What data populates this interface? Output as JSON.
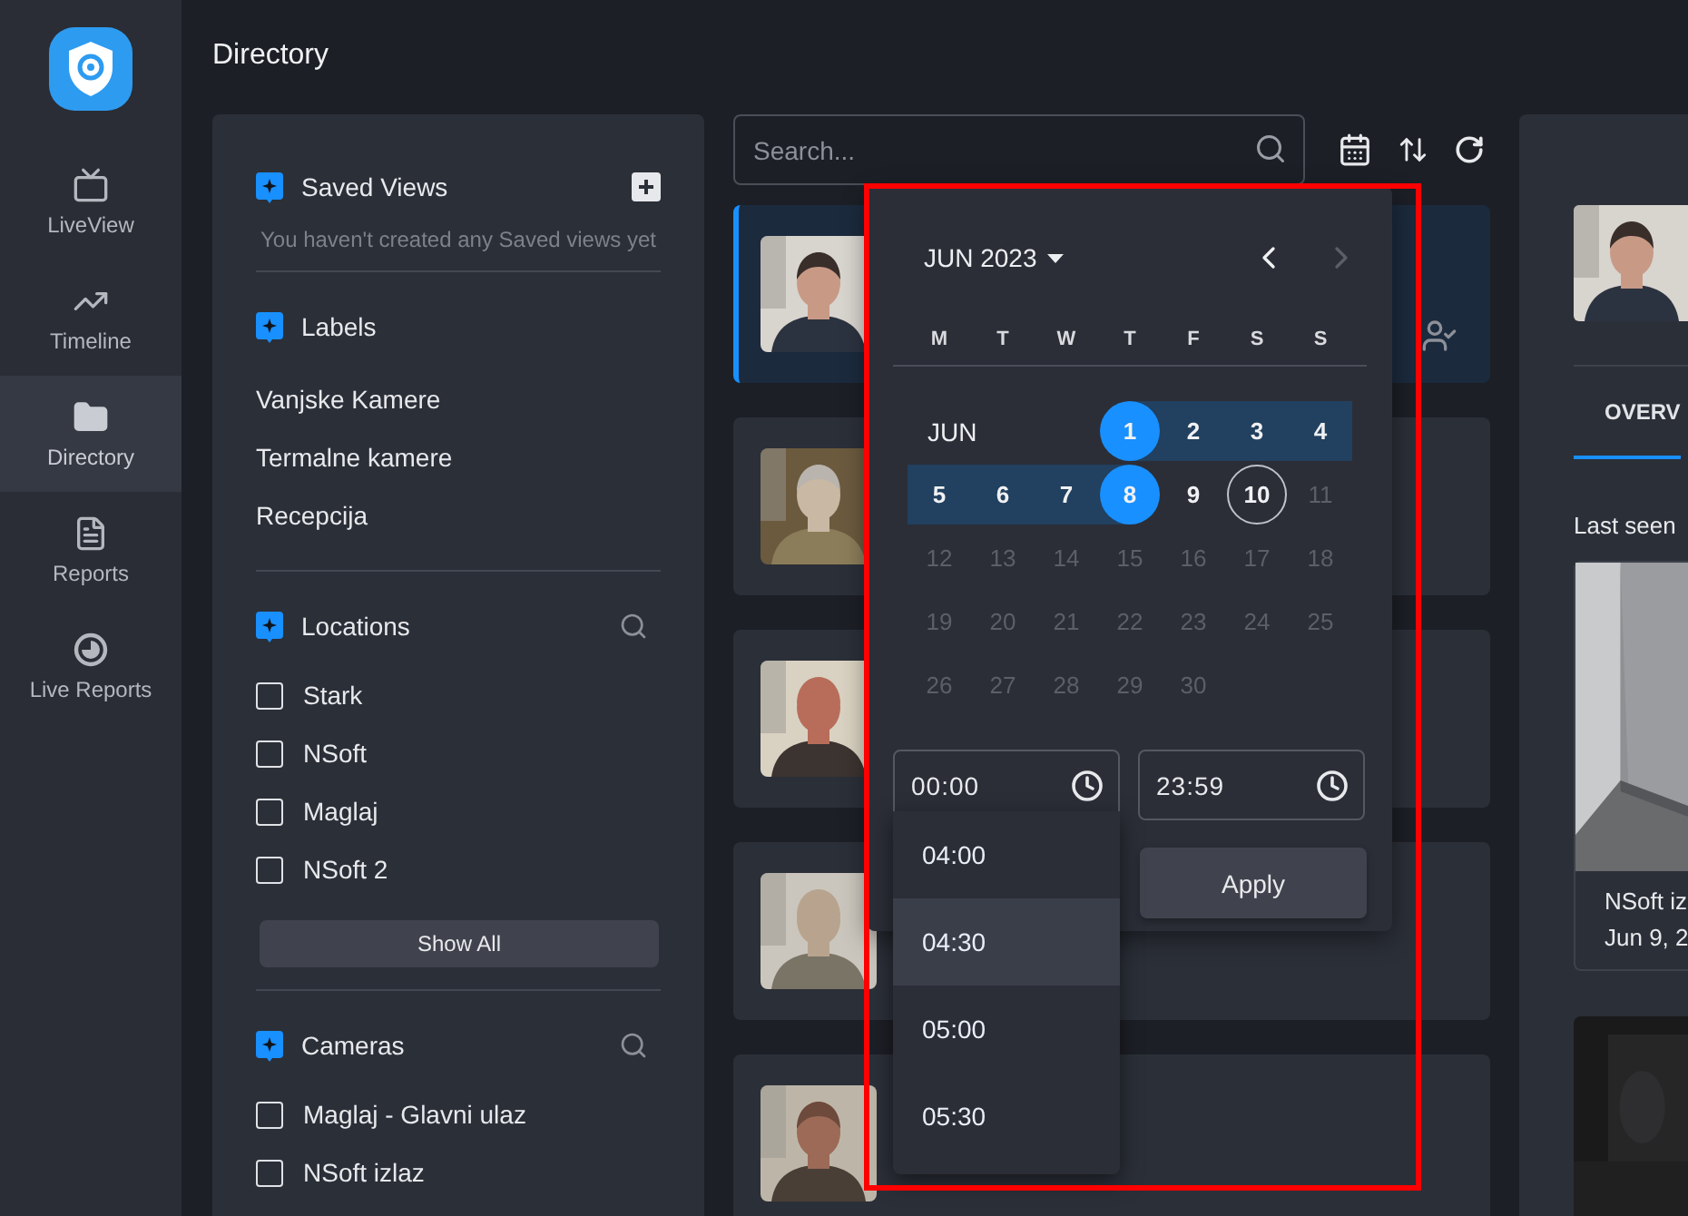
{
  "nav": [
    {
      "label": "LiveView",
      "selected": false
    },
    {
      "label": "Timeline",
      "selected": false
    },
    {
      "label": "Directory",
      "selected": true
    },
    {
      "label": "Reports",
      "selected": false
    },
    {
      "label": "Live Reports",
      "selected": false
    }
  ],
  "page_title": "Directory",
  "filters": {
    "saved_views": {
      "title": "Saved Views",
      "empty_note": "You haven't created any Saved views yet"
    },
    "labels": {
      "title": "Labels",
      "items": [
        "Vanjske Kamere",
        "Termalne kamere",
        "Recepcija"
      ]
    },
    "locations": {
      "title": "Locations",
      "items": [
        {
          "label": "Stark",
          "checked": false
        },
        {
          "label": "NSoft",
          "checked": false
        },
        {
          "label": "Maglaj",
          "checked": false
        },
        {
          "label": "NSoft 2",
          "checked": false
        }
      ],
      "show_all": "Show All"
    },
    "cameras": {
      "title": "Cameras",
      "items": [
        {
          "label": "Maglaj - Glavni ulaz",
          "checked": false
        },
        {
          "label": "NSoft izlaz",
          "checked": false
        }
      ]
    }
  },
  "search": {
    "placeholder": "Search..."
  },
  "cards": [
    {
      "selected": true,
      "confirmed": true
    },
    {
      "selected": false,
      "confirmed": false
    },
    {
      "selected": false,
      "confirmed": false
    },
    {
      "selected": false,
      "confirmed": false
    },
    {
      "selected": false,
      "confirmed": false
    }
  ],
  "calendar": {
    "month": "JUN 2023",
    "weekdays": [
      "M",
      "T",
      "W",
      "T",
      "F",
      "S",
      "S"
    ],
    "row_label": "JUN",
    "days": [
      {
        "label": "1",
        "selected": true,
        "in_range": true,
        "today": false,
        "disabled": false
      },
      {
        "label": "2",
        "selected": false,
        "in_range": true,
        "today": false,
        "disabled": false
      },
      {
        "label": "3",
        "selected": false,
        "in_range": true,
        "today": false,
        "disabled": false
      },
      {
        "label": "4",
        "selected": false,
        "in_range": true,
        "today": false,
        "disabled": false
      },
      {
        "label": "5",
        "selected": false,
        "in_range": true,
        "today": false,
        "disabled": false
      },
      {
        "label": "6",
        "selected": false,
        "in_range": true,
        "today": false,
        "disabled": false
      },
      {
        "label": "7",
        "selected": false,
        "in_range": true,
        "today": false,
        "disabled": false
      },
      {
        "label": "8",
        "selected": true,
        "in_range": true,
        "today": false,
        "disabled": false
      },
      {
        "label": "9",
        "selected": false,
        "in_range": false,
        "today": false,
        "disabled": false
      },
      {
        "label": "10",
        "selected": false,
        "in_range": false,
        "today": true,
        "disabled": false
      },
      {
        "label": "11",
        "selected": false,
        "in_range": false,
        "today": false,
        "disabled": true
      },
      {
        "label": "12",
        "selected": false,
        "in_range": false,
        "today": false,
        "disabled": true
      },
      {
        "label": "13",
        "selected": false,
        "in_range": false,
        "today": false,
        "disabled": true
      },
      {
        "label": "14",
        "selected": false,
        "in_range": false,
        "today": false,
        "disabled": true
      },
      {
        "label": "15",
        "selected": false,
        "in_range": false,
        "today": false,
        "disabled": true
      },
      {
        "label": "16",
        "selected": false,
        "in_range": false,
        "today": false,
        "disabled": true
      },
      {
        "label": "17",
        "selected": false,
        "in_range": false,
        "today": false,
        "disabled": true
      },
      {
        "label": "18",
        "selected": false,
        "in_range": false,
        "today": false,
        "disabled": true
      },
      {
        "label": "19",
        "selected": false,
        "in_range": false,
        "today": false,
        "disabled": true
      },
      {
        "label": "20",
        "selected": false,
        "in_range": false,
        "today": false,
        "disabled": true
      },
      {
        "label": "21",
        "selected": false,
        "in_range": false,
        "today": false,
        "disabled": true
      },
      {
        "label": "22",
        "selected": false,
        "in_range": false,
        "today": false,
        "disabled": true
      },
      {
        "label": "23",
        "selected": false,
        "in_range": false,
        "today": false,
        "disabled": true
      },
      {
        "label": "24",
        "selected": false,
        "in_range": false,
        "today": false,
        "disabled": true
      },
      {
        "label": "25",
        "selected": false,
        "in_range": false,
        "today": false,
        "disabled": true
      },
      {
        "label": "26",
        "selected": false,
        "in_range": false,
        "today": false,
        "disabled": true
      },
      {
        "label": "27",
        "selected": false,
        "in_range": false,
        "today": false,
        "disabled": true
      },
      {
        "label": "28",
        "selected": false,
        "in_range": false,
        "today": false,
        "disabled": true
      },
      {
        "label": "29",
        "selected": false,
        "in_range": false,
        "today": false,
        "disabled": true
      },
      {
        "label": "30",
        "selected": false,
        "in_range": false,
        "today": false,
        "disabled": true
      }
    ],
    "prev_disabled": false,
    "next_disabled": true,
    "start_time": "00:00",
    "end_time": "23:59",
    "time_options": [
      {
        "label": "04:00",
        "highlighted": false
      },
      {
        "label": "04:30",
        "highlighted": true
      },
      {
        "label": "05:00",
        "highlighted": false
      },
      {
        "label": "05:30",
        "highlighted": false
      }
    ],
    "apply": "Apply"
  },
  "detail": {
    "tab": {
      "label": "OVERV",
      "selected": true
    },
    "last_seen": "Last seen",
    "sighting": {
      "camera": "NSoft iz",
      "date": "Jun 9, 2"
    }
  }
}
